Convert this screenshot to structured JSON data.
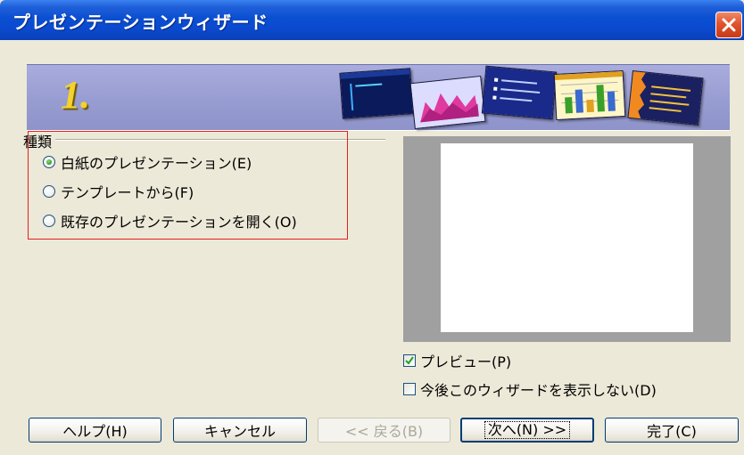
{
  "window": {
    "title": "プレゼンテーションウィザード"
  },
  "banner": {
    "step": "1."
  },
  "section": {
    "label": "種類",
    "options": [
      {
        "label": "白紙のプレゼンテーション(E)",
        "checked": true
      },
      {
        "label": "テンプレートから(F)",
        "checked": false
      },
      {
        "label": "既存のプレゼンテーションを開く(O)",
        "checked": false
      }
    ]
  },
  "preview": {
    "preview_label": "プレビュー(P)",
    "preview_checked": true,
    "dont_show_label": "今後このウィザードを表示しない(D)",
    "dont_show_checked": false
  },
  "buttons": {
    "help": "ヘルプ(H)",
    "cancel": "キャンセル",
    "back": "<< 戻る(B)",
    "next": "次へ(N) >>",
    "finish": "完了(C)"
  },
  "colors": {
    "titlebar": "#0a4fd2",
    "banner": "#9ea3d6",
    "highlight_box": "#e52020"
  }
}
